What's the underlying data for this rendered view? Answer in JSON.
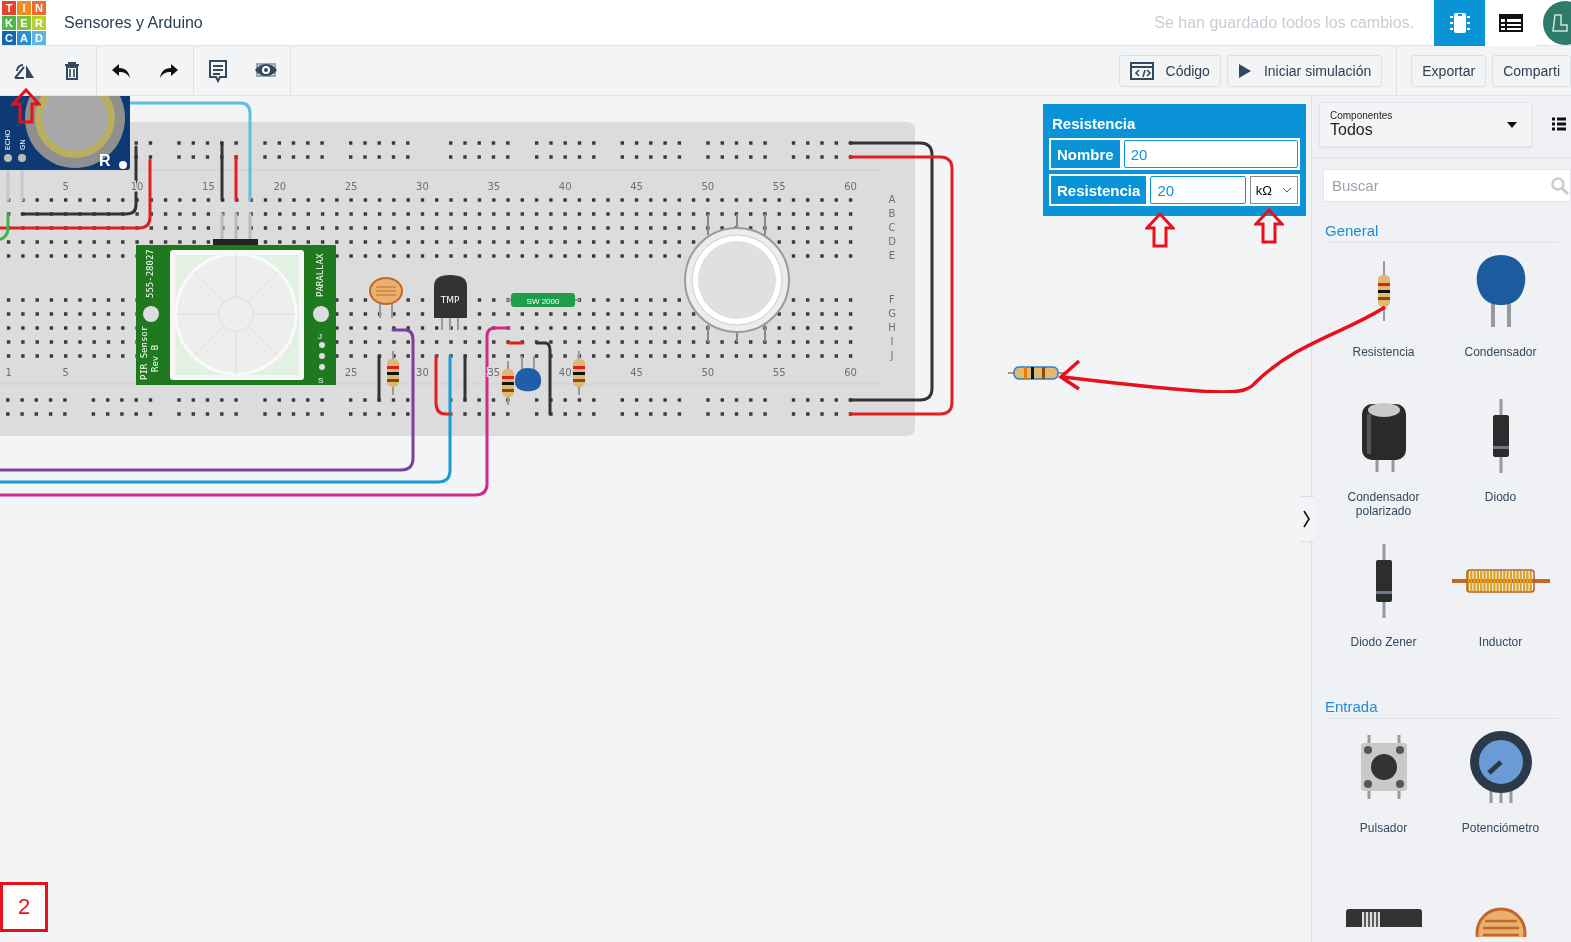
{
  "header": {
    "logo": [
      {
        "letter": "T",
        "color": "#e8432f"
      },
      {
        "letter": "I",
        "color": "#f28b22"
      },
      {
        "letter": "N",
        "color": "#f06b2a"
      },
      {
        "letter": "K",
        "color": "#4fb848"
      },
      {
        "letter": "E",
        "color": "#7cc142"
      },
      {
        "letter": "R",
        "color": "#b5cf35"
      },
      {
        "letter": "C",
        "color": "#1565b3"
      },
      {
        "letter": "A",
        "color": "#2b8fd2"
      },
      {
        "letter": "D",
        "color": "#5db5e1"
      }
    ],
    "title": "Sensores y Arduino",
    "save_status": "Se han guardado todos los cambios.",
    "view_buttons": [
      {
        "kind": "chip",
        "selected": true
      },
      {
        "kind": "table",
        "selected": false
      }
    ]
  },
  "toolbar": {
    "tools": [
      {
        "kind": "rotate"
      },
      {
        "kind": "delete"
      },
      {
        "kind": "undo"
      },
      {
        "kind": "redo"
      },
      {
        "kind": "notes"
      },
      {
        "kind": "visibility"
      }
    ],
    "actions": [
      {
        "kind": "code",
        "label": "Código"
      },
      {
        "kind": "play",
        "label": "Iniciar simulación"
      },
      {
        "kind": "plain",
        "label": "Exportar"
      },
      {
        "kind": "plain",
        "label": "Comparti"
      }
    ]
  },
  "canvas": {
    "top_numbers": [
      "5",
      "10",
      "15",
      "20",
      "25",
      "30",
      "35",
      "40",
      "45",
      "50",
      "55",
      "60"
    ],
    "bottom_numbers": [
      "1",
      "5",
      "25",
      "30",
      "35",
      "40",
      "45",
      "50",
      "55",
      "60"
    ],
    "row_letters": [
      "A",
      "B",
      "C",
      "D",
      "E",
      "F",
      "G",
      "H",
      "I",
      "J"
    ],
    "components": [
      {
        "kind": "ultrasonic",
        "labels": [
          "ECHO",
          "GN",
          "R"
        ]
      },
      {
        "kind": "pir",
        "labels": [
          "555-28027",
          "PARALLAX",
          "PIR Sensor",
          "Rev B",
          "J",
          "S"
        ]
      },
      {
        "kind": "tmp",
        "labels": [
          "TMP"
        ]
      },
      {
        "kind": "reed",
        "labels": [
          "SW 2000"
        ]
      }
    ],
    "step": "2"
  },
  "inspector": {
    "title": "Resistencia",
    "fields": [
      {
        "label": "Nombre",
        "value": "20"
      },
      {
        "label": "Resistencia",
        "value": "20",
        "unit": "kΩ"
      }
    ]
  },
  "sidebar": {
    "filter": {
      "caption": "Componentes",
      "value": "Todos"
    },
    "search": {
      "placeholder": "Buscar"
    },
    "sections": [
      {
        "title": "General",
        "items": [
          {
            "kind": "resistor",
            "label": "Resistencia"
          },
          {
            "kind": "capacitor",
            "label": "Condensador"
          },
          {
            "kind": "polarized",
            "label": "Condensador polarizado"
          },
          {
            "kind": "diode",
            "label": "Diodo"
          },
          {
            "kind": "zener",
            "label": "Diodo Zener"
          },
          {
            "kind": "inductor",
            "label": "Inductor"
          }
        ]
      },
      {
        "title": "Entrada",
        "items": [
          {
            "kind": "pushbutton",
            "label": "Pulsador"
          },
          {
            "kind": "potentiometer",
            "label": "Potenciómetro"
          },
          {
            "kind": "slideswitch"
          },
          {
            "kind": "photoresistor"
          }
        ]
      }
    ]
  }
}
